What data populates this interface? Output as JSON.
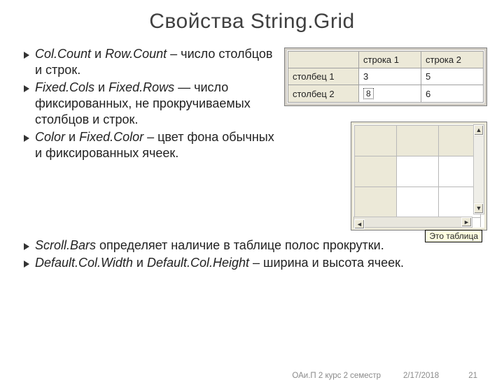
{
  "title": "Свойства String.Grid",
  "bullets_top": [
    {
      "term": "Col.Count",
      "conn": "  и  ",
      "term2": "Row.Count",
      "tail": " – число столбцов и строк."
    },
    {
      "term": "Fixed.Cols",
      "conn": "  и  ",
      "term2": "Fixed.Rows",
      "tail": " — число фиксированных, не прокручиваемых столбцов и строк."
    },
    {
      "term": "Color",
      "conn": "  и  ",
      "term2": "Fixed.Color",
      "tail": "  – цвет фона обычных и фиксированных ячеек."
    }
  ],
  "bullets_bottom": [
    {
      "term": "Scroll.Bars",
      "tail": "  определяет наличие в таблице полос прокрутки."
    },
    {
      "term": "Default.Col.Width",
      "conn": "  и  ",
      "term2": "Default.Col.Height",
      "tail": " – ширина и высота ячеек."
    }
  ],
  "grid1": {
    "headers_row": [
      "",
      "строка 1",
      "строка 2"
    ],
    "rows": [
      {
        "fixed": "столбец 1",
        "c1": "3",
        "c2": "5"
      },
      {
        "fixed": "столбец 2",
        "c1": "8",
        "c2": "6",
        "editing": true
      }
    ]
  },
  "grid2_tooltip": "Это таблица",
  "footer": {
    "course": "ОАи.П 2 курс 2 семестр",
    "date": "2/17/2018",
    "page": "21"
  }
}
